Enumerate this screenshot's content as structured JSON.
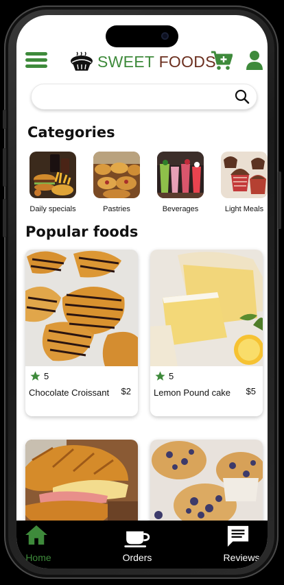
{
  "app": {
    "title_part1": "SWEET",
    "title_part2": "FOODS"
  },
  "colors": {
    "accent": "#3e8a3b",
    "brand_dark": "#6b2f1f",
    "tabbar_bg": "#000000"
  },
  "header": {
    "menu_icon": "hamburger-menu-icon",
    "logo_icon": "pie-logo-icon",
    "cart_icon": "cart-plus-icon",
    "user_icon": "user-icon"
  },
  "search": {
    "value": "",
    "placeholder": "",
    "icon": "search-icon"
  },
  "categories": {
    "title": "Categories",
    "items": [
      {
        "label": "Daily specials",
        "image": "burger-and-fries-photo"
      },
      {
        "label": "Pastries",
        "image": "pastries-photo"
      },
      {
        "label": "Beverages",
        "image": "beverages-photo"
      },
      {
        "label": "Light Meals",
        "image": "cupcakes-photo"
      }
    ]
  },
  "popular": {
    "title": "Popular foods",
    "items": [
      {
        "name": "Chocolate Croissant",
        "price": "$2",
        "rating": "5",
        "image": "chocolate-croissant-photo"
      },
      {
        "name": "Lemon Pound cake",
        "price": "$5",
        "rating": "5",
        "image": "lemon-pound-cake-photo"
      },
      {
        "name": "",
        "price": "",
        "rating": "",
        "image": "croissant-sandwich-photo"
      },
      {
        "name": "",
        "price": "",
        "rating": "",
        "image": "blueberry-muffins-photo"
      }
    ]
  },
  "tabbar": {
    "items": [
      {
        "label": "Home",
        "icon": "home-icon",
        "active": true
      },
      {
        "label": "Orders",
        "icon": "coffee-cup-icon",
        "active": false
      },
      {
        "label": "Reviews",
        "icon": "chat-icon",
        "active": false
      }
    ]
  }
}
